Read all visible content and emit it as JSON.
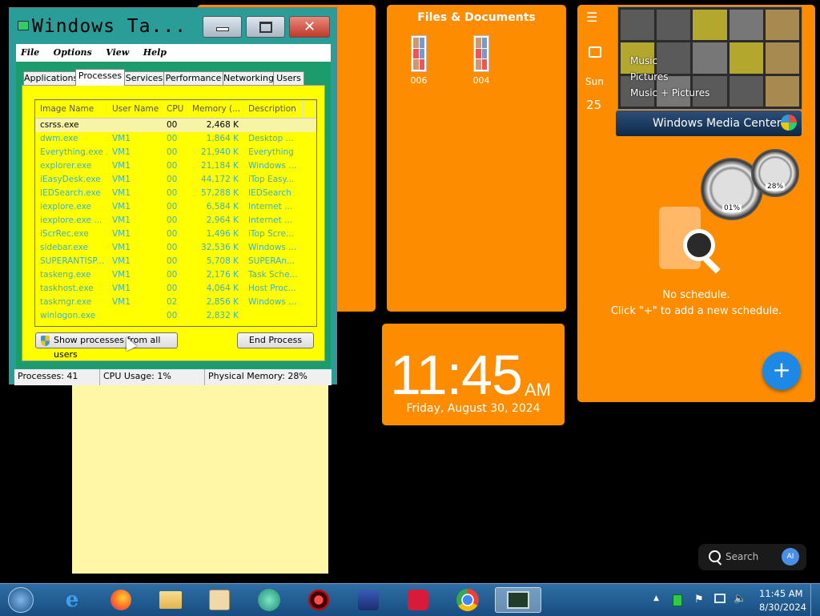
{
  "taskmgr": {
    "title": "Windows Ta...",
    "menu": [
      "File",
      "Options",
      "View",
      "Help"
    ],
    "tabs": [
      "Applications",
      "Processes",
      "Services",
      "Performance",
      "Networking",
      "Users"
    ],
    "columns": [
      "Image Name",
      "User Name",
      "CPU",
      "Memory (...",
      "Description"
    ],
    "rows": [
      {
        "name": "csrss.exe",
        "user": "",
        "cpu": "00",
        "mem": "2,468 K",
        "desc": ""
      },
      {
        "name": "dwm.exe",
        "user": "VM1",
        "cpu": "00",
        "mem": "1,864 K",
        "desc": "Desktop ..."
      },
      {
        "name": "Everything.exe ...",
        "user": "VM1",
        "cpu": "00",
        "mem": "21,940 K",
        "desc": "Everything"
      },
      {
        "name": "explorer.exe",
        "user": "VM1",
        "cpu": "00",
        "mem": "21,184 K",
        "desc": "Windows ..."
      },
      {
        "name": "iEasyDesk.exe",
        "user": "VM1",
        "cpu": "00",
        "mem": "44,172 K",
        "desc": "iTop Easy..."
      },
      {
        "name": "IEDSearch.exe",
        "user": "VM1",
        "cpu": "00",
        "mem": "57,288 K",
        "desc": "IEDSearch"
      },
      {
        "name": "iexplore.exe",
        "user": "VM1",
        "cpu": "00",
        "mem": "6,584 K",
        "desc": "Internet ..."
      },
      {
        "name": "iexplore.exe ...",
        "user": "VM1",
        "cpu": "00",
        "mem": "2,964 K",
        "desc": "Internet ..."
      },
      {
        "name": "iScrRec.exe",
        "user": "VM1",
        "cpu": "00",
        "mem": "1,496 K",
        "desc": "iTop Scre..."
      },
      {
        "name": "sidebar.exe",
        "user": "VM1",
        "cpu": "00",
        "mem": "32,536 K",
        "desc": "Windows ..."
      },
      {
        "name": "SUPERANTISP...",
        "user": "VM1",
        "cpu": "00",
        "mem": "5,708 K",
        "desc": "SUPERAn..."
      },
      {
        "name": "taskeng.exe",
        "user": "VM1",
        "cpu": "00",
        "mem": "2,176 K",
        "desc": "Task Sche..."
      },
      {
        "name": "taskhost.exe",
        "user": "VM1",
        "cpu": "00",
        "mem": "4,064 K",
        "desc": "Host Proc..."
      },
      {
        "name": "taskmgr.exe",
        "user": "VM1",
        "cpu": "02",
        "mem": "2,856 K",
        "desc": "Windows ..."
      },
      {
        "name": "winlogon.exe",
        "user": "",
        "cpu": "00",
        "mem": "2,832 K",
        "desc": ""
      }
    ],
    "show_all_label": "Show processes from all users",
    "end_process_label": "End Process",
    "status": {
      "processes": "Processes: 41",
      "cpu": "CPU Usage: 1%",
      "memory": "Physical Memory: 28%"
    }
  },
  "files": {
    "title": "Files & Documents",
    "items": [
      {
        "name": "006"
      },
      {
        "name": "004"
      }
    ]
  },
  "clock": {
    "time": "11:45",
    "ampm": "AM",
    "date": "Friday, August 30, 2024"
  },
  "calendar": {
    "weekday": "Sun",
    "day": "25"
  },
  "media_center": {
    "items": [
      "Music",
      "Pictures",
      "Music + Pictures"
    ],
    "bar_label_1": "Windows",
    "bar_label_2": "Media Center"
  },
  "gauges": {
    "cpu": "01%",
    "memory": "28%"
  },
  "schedule": {
    "empty": "No schedule.",
    "hint": "Click \"+\" to add a new schedule.",
    "add": "+"
  },
  "search": {
    "placeholder": "Search",
    "ai_badge": "AI"
  },
  "tray": {
    "time": "11:45 AM",
    "date": "8/30/2024"
  },
  "colors": {
    "tile": "#fd8c00",
    "panel": "#ffff00",
    "accent": "#1e88e5"
  }
}
